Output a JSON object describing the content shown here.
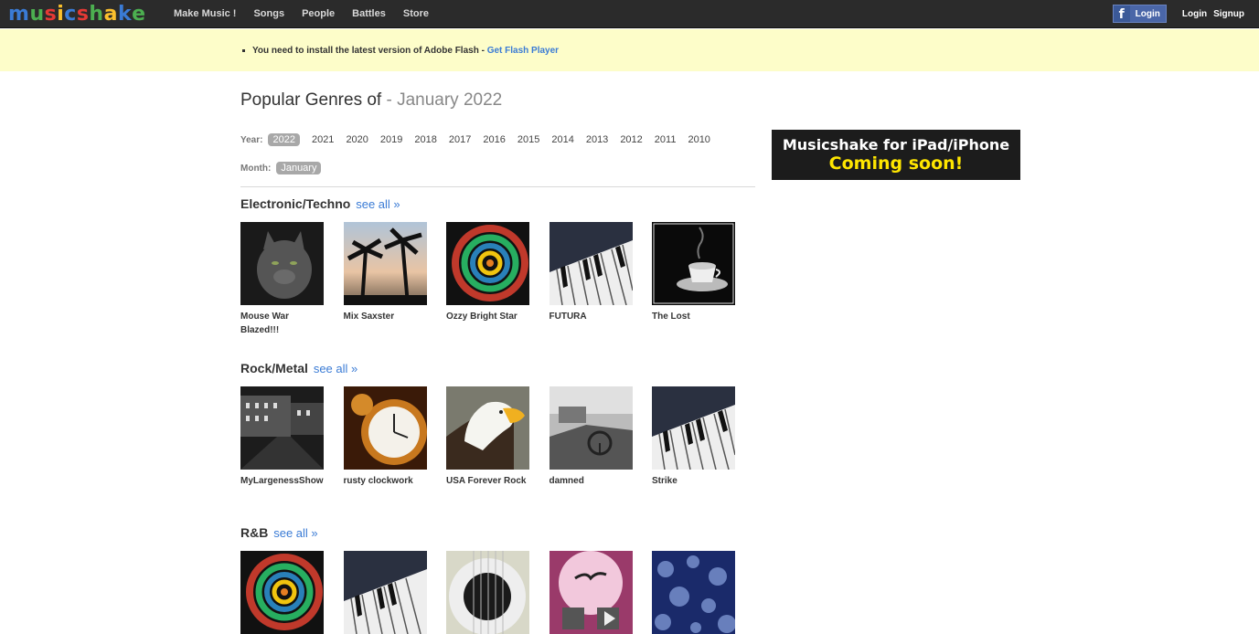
{
  "header": {
    "logo": [
      "m",
      "u",
      "s",
      "i",
      "c",
      "s",
      "h",
      "a",
      "k",
      "e"
    ],
    "logo_colors": [
      "#3a7bd5",
      "#4caf50",
      "#e53935",
      "#fbc02d",
      "#3a7bd5",
      "#e53935",
      "#4caf50",
      "#fbc02d",
      "#3a7bd5",
      "#4caf50"
    ],
    "nav": [
      "Make Music !",
      "Songs",
      "People",
      "Battles",
      "Store"
    ],
    "fb_login": "Login",
    "login": "Login",
    "signup": "Signup"
  },
  "notice": {
    "text": "You need to install the latest version of Adobe Flash - ",
    "link": "Get Flash Player"
  },
  "title": {
    "main": "Popular Genres of ",
    "sub": "- January 2022"
  },
  "filters": {
    "year_label": "Year:",
    "years": [
      "2022",
      "2021",
      "2020",
      "2019",
      "2018",
      "2017",
      "2016",
      "2015",
      "2014",
      "2013",
      "2012",
      "2011",
      "2010"
    ],
    "month_label": "Month:",
    "month": "January"
  },
  "ad": {
    "line1": "Musicshake for iPad/iPhone",
    "line2": "Coming soon!"
  },
  "see_all": "see all »",
  "genres": [
    {
      "name": "Electronic/Techno",
      "items": [
        {
          "title": "Mouse War Blazed!!!",
          "icon": "cat-photo"
        },
        {
          "title": "Mix Saxster",
          "icon": "palm-sunset-photo"
        },
        {
          "title": "Ozzy Bright Star",
          "icon": "fractal-spiral-photo"
        },
        {
          "title": "FUTURA",
          "icon": "piano-keys-photo"
        },
        {
          "title": "The Lost",
          "icon": "coffee-cup-photo"
        }
      ]
    },
    {
      "name": "Rock/Metal",
      "items": [
        {
          "title": "MyLargenessShow",
          "icon": "night-street-photo"
        },
        {
          "title": "rusty clockwork",
          "icon": "clock-photo"
        },
        {
          "title": "USA Forever Rock",
          "icon": "eagle-photo"
        },
        {
          "title": "damned",
          "icon": "old-car-photo"
        },
        {
          "title": "Strike",
          "icon": "piano-keys-photo"
        }
      ]
    },
    {
      "name": "R&B",
      "items": [
        {
          "title": "",
          "icon": "fractal-spiral-photo"
        },
        {
          "title": "",
          "icon": "piano-keys-photo"
        },
        {
          "title": "",
          "icon": "guitar-photo"
        },
        {
          "title": "",
          "icon": "bird-pink-photo"
        },
        {
          "title": "",
          "icon": "blue-bokeh-photo"
        }
      ]
    }
  ]
}
